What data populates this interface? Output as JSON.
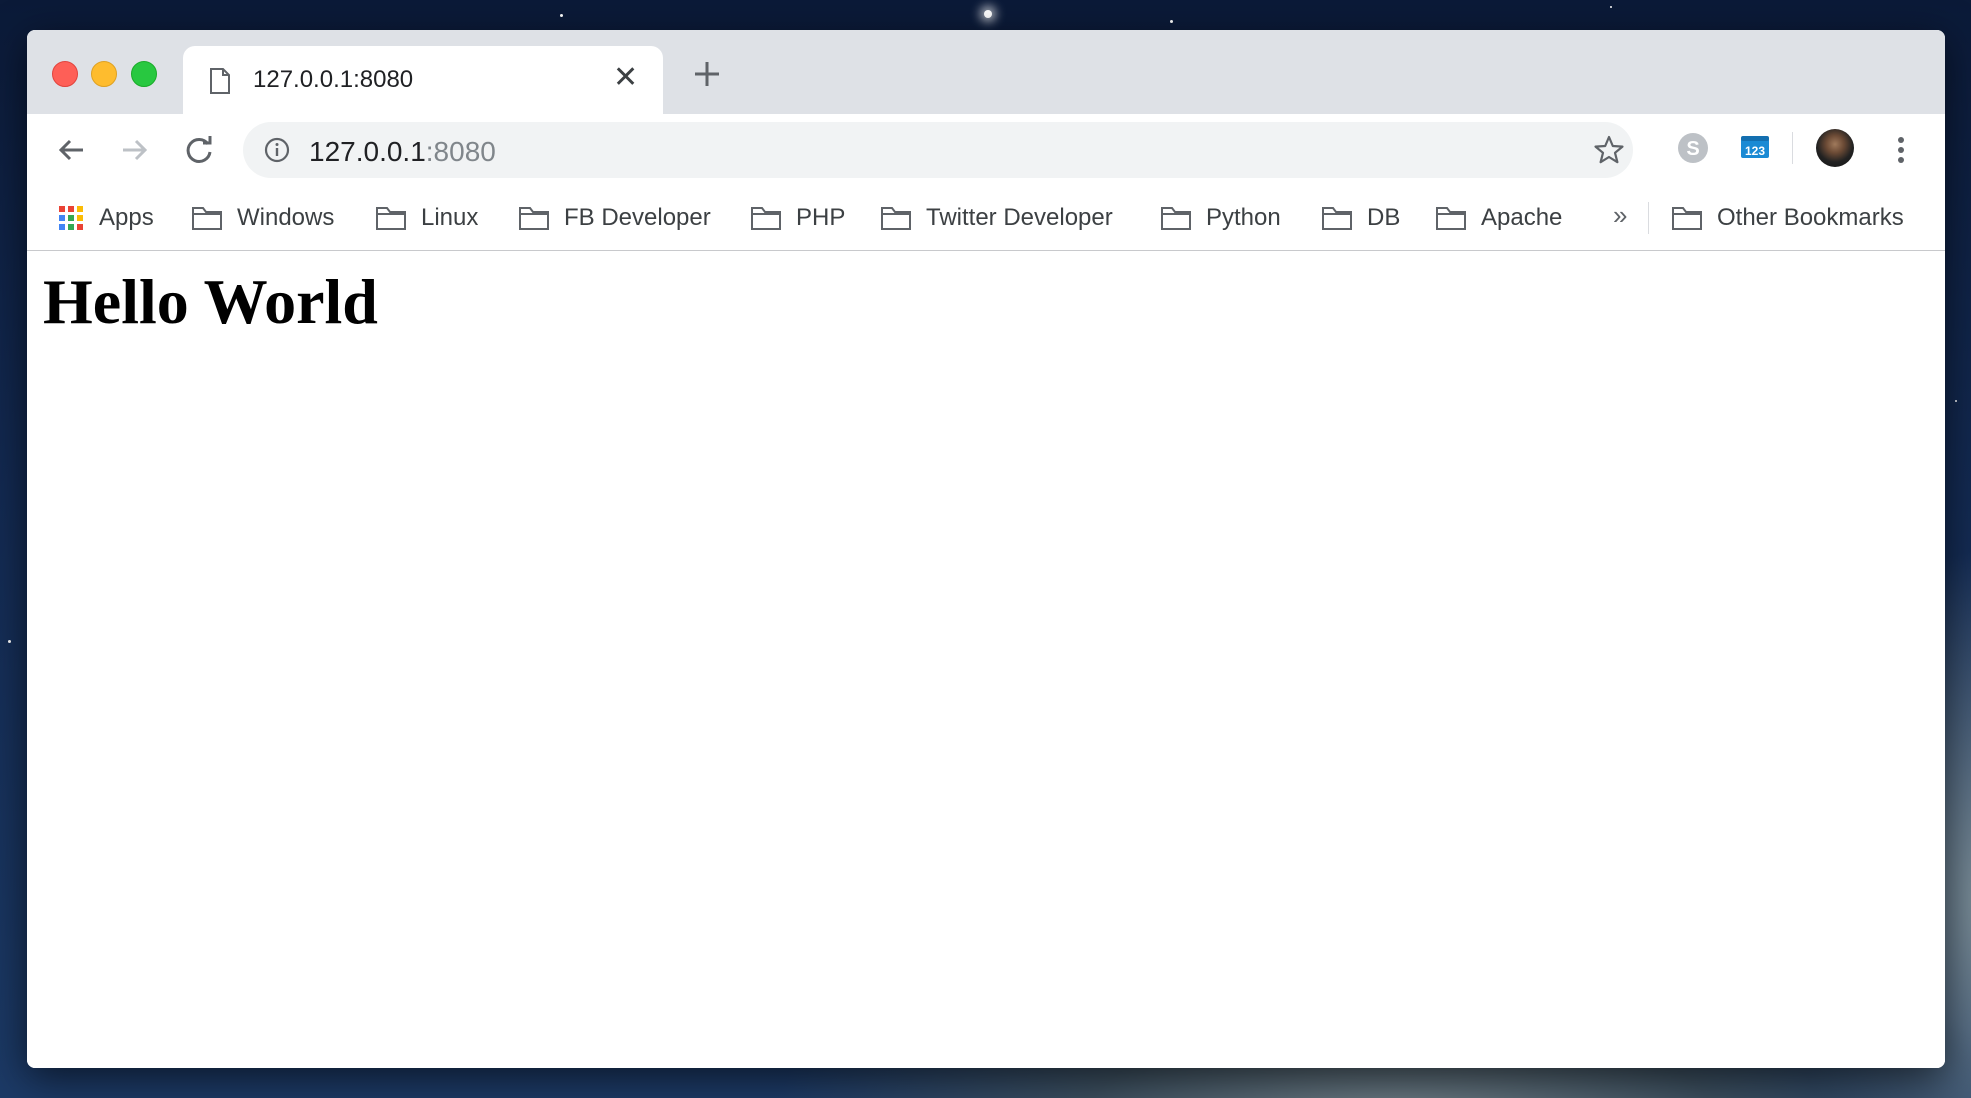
{
  "browser": {
    "tab": {
      "title": "127.0.0.1:8080",
      "icon": "document-icon"
    },
    "address_bar": {
      "host": "127.0.0.1",
      "port": ":8080"
    },
    "extensions": [
      "skype-icon",
      "calendar-123-icon"
    ],
    "bookmarks": {
      "apps_label": "Apps",
      "folders": [
        "Windows",
        "Linux",
        "FB Developer",
        "PHP",
        "Twitter Developer",
        "Python",
        "DB",
        "Apache"
      ],
      "overflow_label": "»",
      "other_label": "Other Bookmarks"
    }
  },
  "page": {
    "heading": "Hello World"
  }
}
